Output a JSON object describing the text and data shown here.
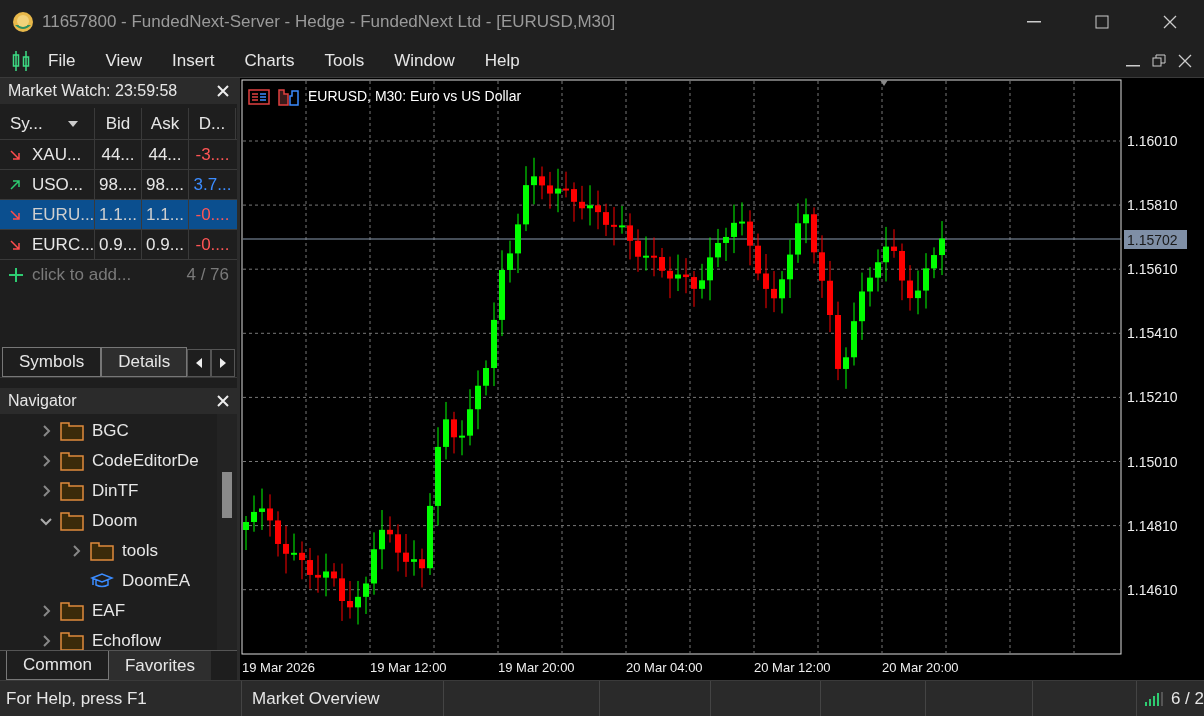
{
  "window": {
    "title": "11657800 - FundedNext-Server - Hedge - FundedNext Ltd - [EURUSD,M30]"
  },
  "menu": [
    "File",
    "View",
    "Insert",
    "Charts",
    "Tools",
    "Window",
    "Help"
  ],
  "market_watch": {
    "title": "Market Watch: 23:59:58",
    "columns": [
      "Sy...",
      "Bid",
      "Ask",
      "D..."
    ],
    "rows": [
      {
        "symbol": "XAU...",
        "bid": "44...",
        "ask": "44...",
        "daily": "-3....",
        "rising": false,
        "selected": false
      },
      {
        "symbol": "USO...",
        "bid": "98....",
        "ask": "98....",
        "daily": "3.7...",
        "rising": true,
        "selected": false
      },
      {
        "symbol": "EURU...",
        "bid": "1.1...",
        "ask": "1.1...",
        "daily": "-0....",
        "rising": false,
        "selected": true
      },
      {
        "symbol": "EURC...",
        "bid": "0.9...",
        "ask": "0.9...",
        "daily": "-0....",
        "rising": false,
        "selected": false
      }
    ],
    "add_hint": "click to add...",
    "count": "4 / 76",
    "tabs": [
      {
        "label": "Symbols",
        "selected": true
      },
      {
        "label": "Details",
        "selected": false
      }
    ]
  },
  "navigator": {
    "title": "Navigator",
    "tree": [
      {
        "label": "BGC",
        "kind": "folder",
        "expanded": false
      },
      {
        "label": "CodeEditorDe",
        "kind": "folder",
        "expanded": false
      },
      {
        "label": "DinTF",
        "kind": "folder",
        "expanded": false
      },
      {
        "label": "Doom",
        "kind": "folder",
        "expanded": true,
        "children": [
          {
            "label": "tools",
            "kind": "folder",
            "expanded": false
          },
          {
            "label": "DoomEA",
            "kind": "expert"
          }
        ]
      },
      {
        "label": "EAF",
        "kind": "folder",
        "expanded": false
      },
      {
        "label": "Echoflow",
        "kind": "folder",
        "expanded": false
      }
    ],
    "tabs": [
      {
        "label": "Common",
        "selected": true
      },
      {
        "label": "Favorites",
        "selected": false
      }
    ]
  },
  "chart": {
    "title": "EURUSD, M30:  Euro vs US Dollar",
    "price_labels": [
      "1.16010",
      "1.15810",
      "1.15610",
      "1.15410",
      "1.15210",
      "1.15010",
      "1.14810",
      "1.14610"
    ],
    "current_price": "1.15702",
    "time_labels": [
      "19 Mar 2026",
      "19 Mar 12:00",
      "19 Mar 20:00",
      "20 Mar 04:00",
      "20 Mar 12:00",
      "20 Mar 20:00"
    ]
  },
  "status_bar": {
    "help": "For Help, press F1",
    "section": "Market Overview",
    "connection": "6 / 2"
  }
}
